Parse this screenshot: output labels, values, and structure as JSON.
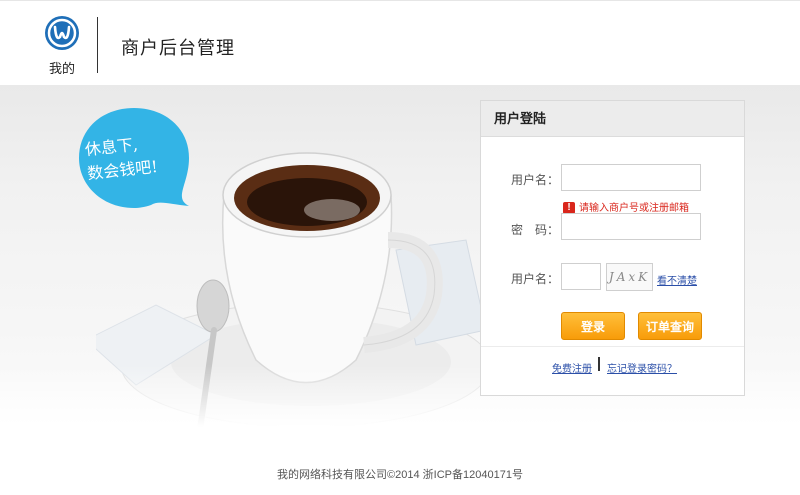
{
  "header": {
    "logo_text": "我的",
    "title": "商户后台管理"
  },
  "banner": {
    "bubble_line1": "休息下,",
    "bubble_line2": "数会钱吧!"
  },
  "login": {
    "title": "用户登陆",
    "username_label": "用户名：",
    "username_value": "",
    "error_text": "请输入商户号或注册邮箱",
    "password_label": "密　码：",
    "password_value": "",
    "captcha_label": "用户名：",
    "captcha_value": "",
    "captcha_image_text": "JAxK",
    "refresh_link": "看不清楚",
    "login_button": "登录",
    "order_button": "订单查询",
    "register_link": "免费注册",
    "forgot_link": "忘记登录密码？"
  },
  "footer": {
    "text": "我的网络科技有限公司©2014 浙ICP备12040171号"
  },
  "colors": {
    "accent_orange": "#f89c09",
    "bubble_blue": "#33b4e6",
    "link_blue": "#2b4fa8",
    "error_red": "#d9261c"
  }
}
